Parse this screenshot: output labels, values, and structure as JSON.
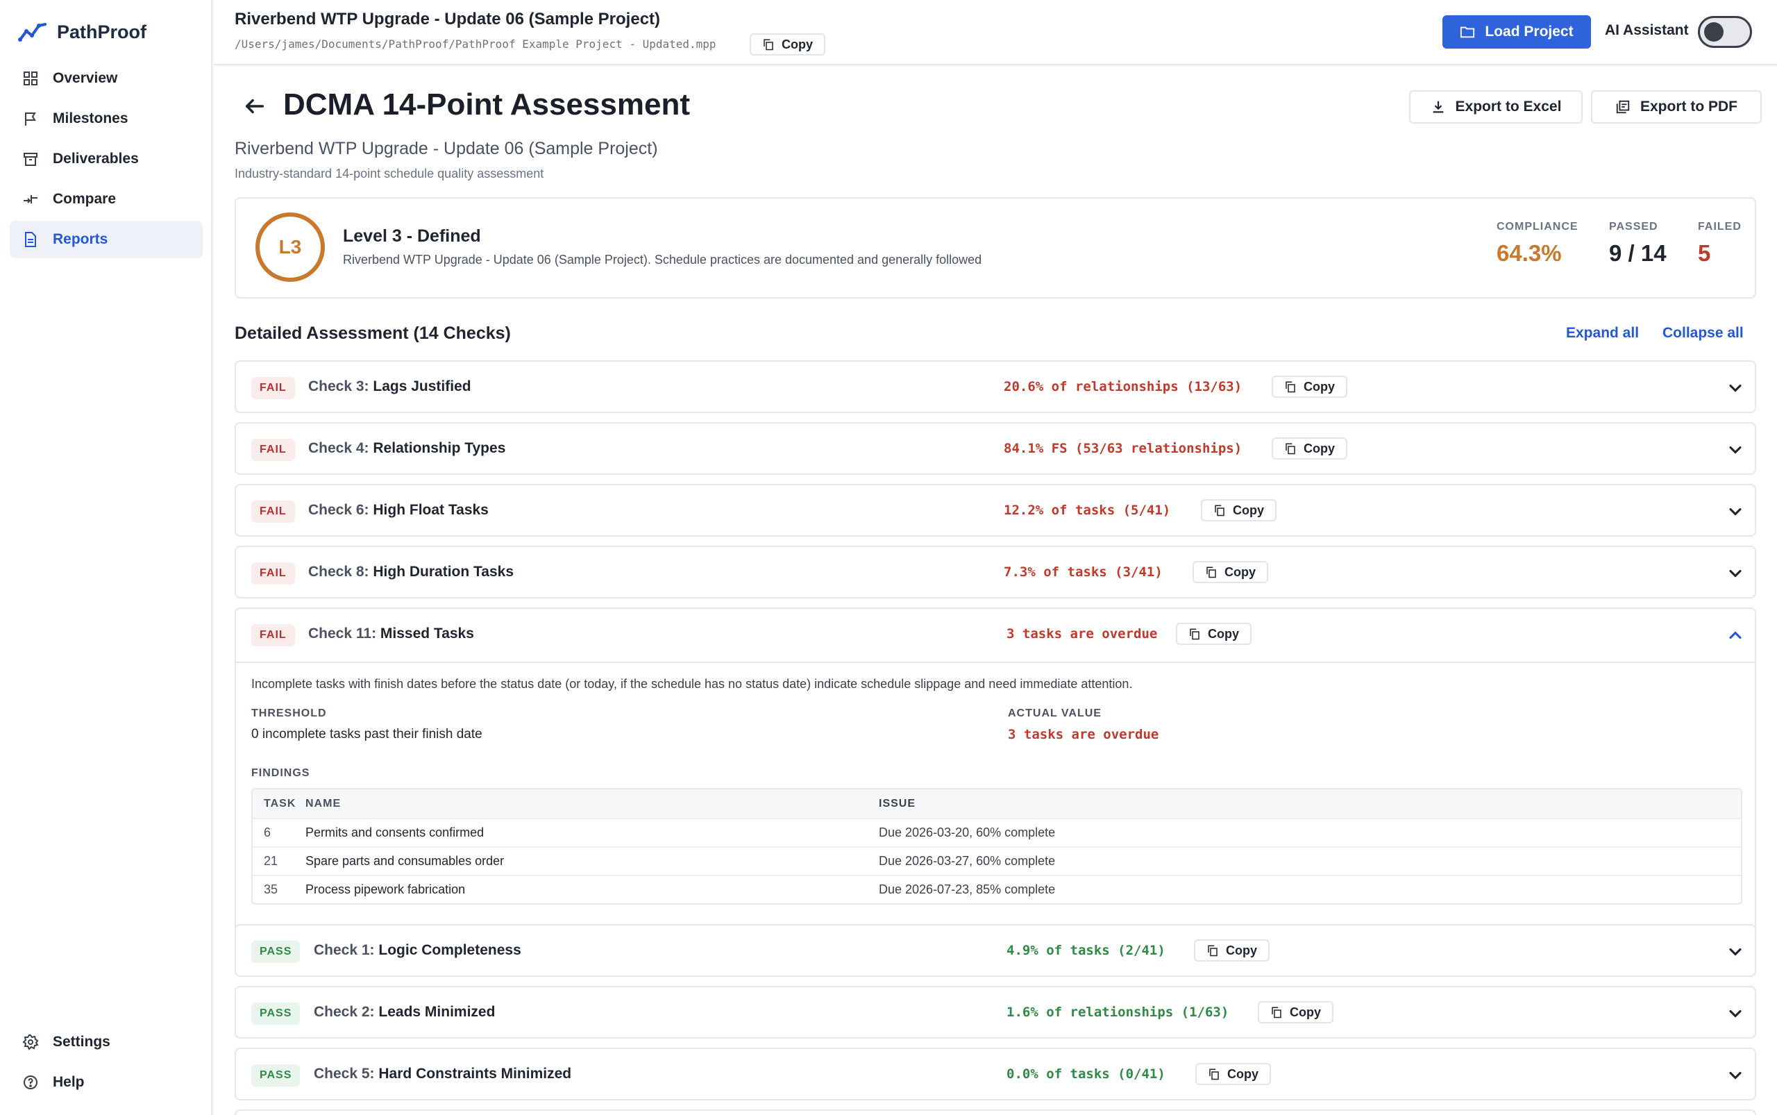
{
  "app": {
    "name": "PathProof"
  },
  "sidebar": {
    "items": [
      {
        "label": "Overview",
        "icon": "grid-icon"
      },
      {
        "label": "Milestones",
        "icon": "flag-icon"
      },
      {
        "label": "Deliverables",
        "icon": "archive-icon"
      },
      {
        "label": "Compare",
        "icon": "compare-icon"
      },
      {
        "label": "Reports",
        "icon": "document-icon",
        "active": true
      }
    ],
    "bottom": [
      {
        "label": "Settings",
        "icon": "gear-icon"
      },
      {
        "label": "Help",
        "icon": "help-icon"
      }
    ]
  },
  "topbar": {
    "project_title": "Riverbend WTP Upgrade - Update 06 (Sample Project)",
    "project_path": "/Users/james/Documents/PathProof/PathProof Example Project - Updated.mpp",
    "copy_label": "Copy",
    "load_label": "Load Project",
    "ai_label": "AI Assistant",
    "ai_enabled": false
  },
  "page": {
    "title": "DCMA 14-Point Assessment",
    "subtitle": "Riverbend WTP Upgrade - Update 06 (Sample Project)",
    "description": "Industry-standard 14-point schedule quality assessment",
    "export_excel": "Export to Excel",
    "export_pdf": "Export to PDF"
  },
  "summary": {
    "level_badge": "L3",
    "level_title": "Level 3 - Defined",
    "level_desc": "Riverbend WTP Upgrade - Update 06 (Sample Project). Schedule practices are documented and generally followed",
    "compliance_label": "COMPLIANCE",
    "compliance_value": "64.3%",
    "passed_label": "PASSED",
    "passed_value": "9 / 14",
    "failed_label": "FAILED",
    "failed_value": "5",
    "colors": {
      "level": "#c9792e",
      "failed": "#c0392b"
    }
  },
  "assessment": {
    "title": "Detailed Assessment (14 Checks)",
    "expand_all": "Expand all",
    "collapse_all": "Collapse all",
    "checks": [
      {
        "status": "FAIL",
        "num": "Check 3:",
        "title": "Lags Justified",
        "result": "20.6% of relationships (13/63)",
        "copy": "Copy"
      },
      {
        "status": "FAIL",
        "num": "Check 4:",
        "title": "Relationship Types",
        "result": "84.1% FS (53/63 relationships)",
        "copy": "Copy"
      },
      {
        "status": "FAIL",
        "num": "Check 6:",
        "title": "High Float Tasks",
        "result": "12.2% of tasks (5/41)",
        "copy": "Copy"
      },
      {
        "status": "FAIL",
        "num": "Check 8:",
        "title": "High Duration Tasks",
        "result": "7.3% of tasks (3/41)",
        "copy": "Copy"
      },
      {
        "status": "FAIL",
        "num": "Check 11:",
        "title": "Missed Tasks",
        "result": "3 tasks are overdue",
        "copy": "Copy",
        "expanded": true
      },
      {
        "status": "PASS",
        "num": "Check 1:",
        "title": "Logic Completeness",
        "result": "4.9% of tasks (2/41)",
        "copy": "Copy"
      },
      {
        "status": "PASS",
        "num": "Check 2:",
        "title": "Leads Minimized",
        "result": "1.6% of relationships (1/63)",
        "copy": "Copy"
      },
      {
        "status": "PASS",
        "num": "Check 5:",
        "title": "Hard Constraints Minimized",
        "result": "0.0% of tasks (0/41)",
        "copy": "Copy"
      }
    ],
    "detail": {
      "description": "Incomplete tasks with finish dates before the status date (or today, if the schedule has no status date) indicate schedule slippage and need immediate attention.",
      "threshold_label": "THRESHOLD",
      "threshold_value": "0 incomplete tasks past their finish date",
      "actual_label": "ACTUAL VALUE",
      "actual_value": "3 tasks are overdue",
      "findings_label": "FINDINGS",
      "columns": [
        "TASK",
        "NAME",
        "ISSUE"
      ],
      "rows": [
        {
          "task": "6",
          "name": "Permits and consents confirmed",
          "issue": "Due 2026-03-20, 60% complete"
        },
        {
          "task": "21",
          "name": "Spare parts and consumables order",
          "issue": "Due 2026-03-27, 60% complete"
        },
        {
          "task": "35",
          "name": "Process pipework fabrication",
          "issue": "Due 2026-07-23, 85% complete"
        }
      ]
    }
  }
}
